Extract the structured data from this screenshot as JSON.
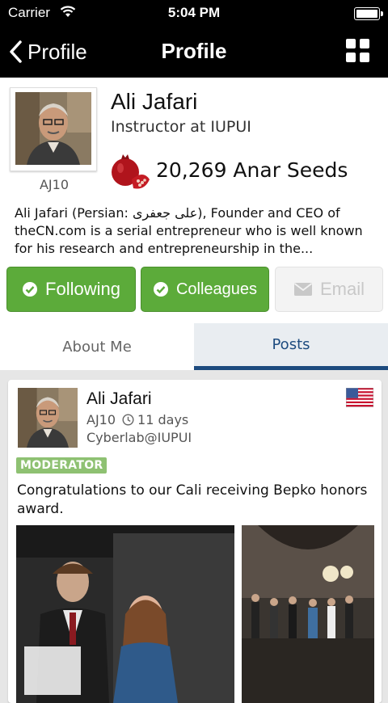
{
  "status_bar": {
    "carrier": "Carrier",
    "time": "5:04 PM"
  },
  "nav": {
    "back_label": "Profile",
    "title": "Profile"
  },
  "profile": {
    "name": "Ali Jafari",
    "role": "Instructor at IUPUI",
    "handle": "AJ10",
    "seeds": "20,269 Anar Seeds",
    "bio": "Ali Jafari (Persian: علی جعفری), Founder and CEO of theCN.com is a serial entrepreneur who is well known for his research and entrepreneurship in the..."
  },
  "actions": {
    "following": "Following",
    "colleagues": "Colleagues",
    "email": "Email"
  },
  "tabs": [
    {
      "label": "About Me"
    },
    {
      "label": "Posts"
    }
  ],
  "post": {
    "author": "Ali Jafari",
    "handle": "AJ10",
    "time": "11 days",
    "lab": "Cyberlab@IUPUI",
    "badge": "MODERATOR",
    "text": "Congratulations to our Cali receiving Bepko honors award."
  },
  "colors": {
    "green": "#5cab3a",
    "tab_active": "#1d4b7f",
    "badge": "#8ec172"
  },
  "icons": [
    "wifi-icon",
    "battery-icon",
    "back-chevron-icon",
    "grid-menu-icon",
    "pomegranate-icon",
    "check-circle-icon",
    "envelope-icon",
    "clock-icon",
    "us-flag-icon"
  ]
}
